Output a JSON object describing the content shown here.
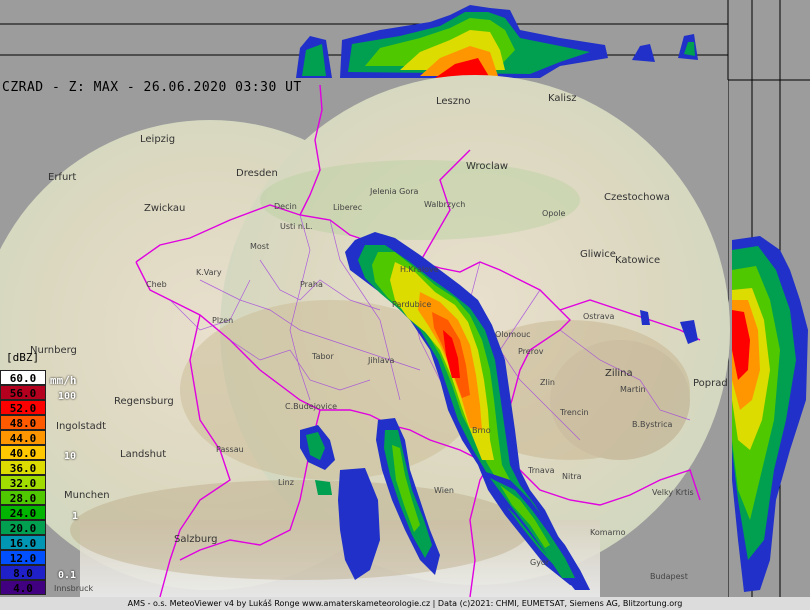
{
  "title": "CZRAD - Z: MAX - 26.06.2020 03:30 UT",
  "legend": {
    "unit_dbz": "[dBZ]",
    "unit_rain": "mm/h",
    "levels": [
      {
        "label": "60.0",
        "color": "#ffffff"
      },
      {
        "label": "56.0",
        "color": "#b4001e"
      },
      {
        "label": "52.0",
        "color": "#ff0000"
      },
      {
        "label": "48.0",
        "color": "#ff5a00"
      },
      {
        "label": "44.0",
        "color": "#ff9600"
      },
      {
        "label": "40.0",
        "color": "#ffc800"
      },
      {
        "label": "36.0",
        "color": "#dcdc00"
      },
      {
        "label": "32.0",
        "color": "#a0dc00"
      },
      {
        "label": "28.0",
        "color": "#50c800"
      },
      {
        "label": "24.0",
        "color": "#00b400"
      },
      {
        "label": "20.0",
        "color": "#00a050"
      },
      {
        "label": "16.0",
        "color": "#0096b4"
      },
      {
        "label": "12.0",
        "color": "#0050ff"
      },
      {
        "label": "8.0",
        "color": "#2020c8"
      },
      {
        "label": "4.0",
        "color": "#400080"
      }
    ],
    "rain_rates": [
      "100",
      "10",
      "1",
      "0.1"
    ]
  },
  "cities": [
    {
      "name": "Leszno"
    },
    {
      "name": "Kalisz"
    },
    {
      "name": "Leipzig"
    },
    {
      "name": "Wroclaw"
    },
    {
      "name": "Erfurt"
    },
    {
      "name": "Dresden"
    },
    {
      "name": "Jelenia Gora"
    },
    {
      "name": "Walbrzych"
    },
    {
      "name": "Czestochowa"
    },
    {
      "name": "Zwickau"
    },
    {
      "name": "Opole"
    },
    {
      "name": "Decin"
    },
    {
      "name": "Liberec"
    },
    {
      "name": "Usti n.L."
    },
    {
      "name": "Gliwice"
    },
    {
      "name": "Katowice"
    },
    {
      "name": "Most"
    },
    {
      "name": "Cheb"
    },
    {
      "name": "K.Vary"
    },
    {
      "name": "Praha"
    },
    {
      "name": "Ostrava"
    },
    {
      "name": "Plzen"
    },
    {
      "name": "Nurnberg"
    },
    {
      "name": "Tabor"
    },
    {
      "name": "Jihlava"
    },
    {
      "name": "Prerov"
    },
    {
      "name": "Zilina"
    },
    {
      "name": "Zlin"
    },
    {
      "name": "Martin"
    },
    {
      "name": "Poprad"
    },
    {
      "name": "Regensburg"
    },
    {
      "name": "C.Budejovice"
    },
    {
      "name": "Trencin"
    },
    {
      "name": "Ingolstadt"
    },
    {
      "name": "B.Bystrica"
    },
    {
      "name": "Passau"
    },
    {
      "name": "Landshut"
    },
    {
      "name": "Linz"
    },
    {
      "name": "Wien"
    },
    {
      "name": "Nitra"
    },
    {
      "name": "Velky Krtis"
    },
    {
      "name": "Munchen"
    },
    {
      "name": "Salzburg"
    },
    {
      "name": "Budapest"
    },
    {
      "name": "Innsbruck"
    },
    {
      "name": "Gyor"
    },
    {
      "name": "Brno"
    },
    {
      "name": "Trnava"
    },
    {
      "name": "Komarno"
    },
    {
      "name": "Olomouc"
    },
    {
      "name": "Pardubice"
    },
    {
      "name": "H.Kralove"
    }
  ],
  "footer": "AMS - o.s. MeteoViewer v4 by Lukáš Ronge www.amaterskameteorologie.cz | Data (c)2021: CHMI, EUMETSAT, Siemens AG, Blitzortung.org"
}
